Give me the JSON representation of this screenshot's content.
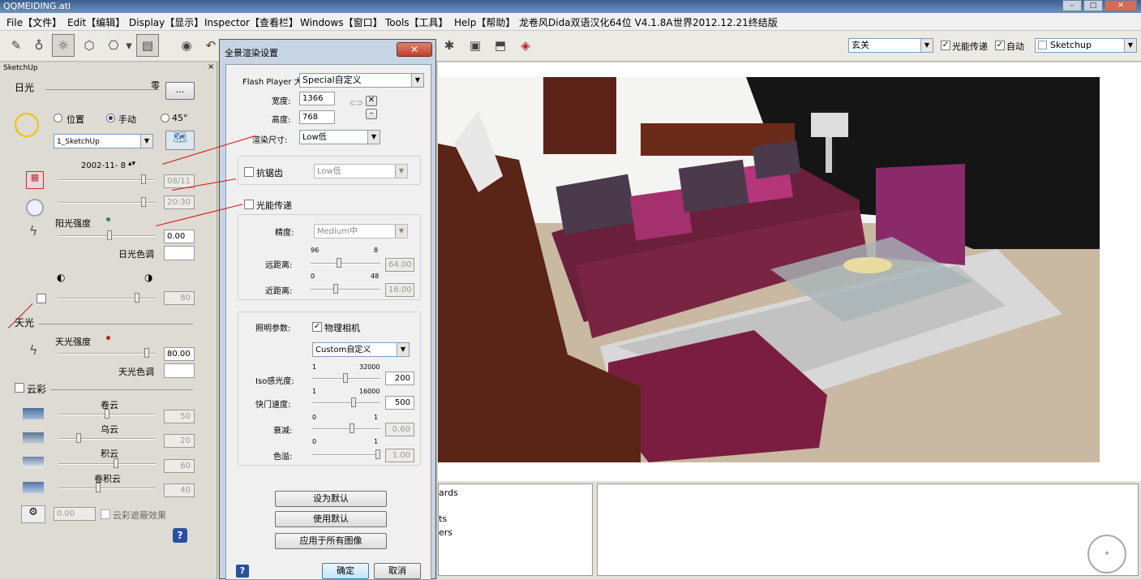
{
  "window": {
    "title": "QQMEIDING.atl"
  },
  "menu": [
    "File【文件】",
    "Edit【编辑】",
    "Display【显示】",
    "Inspector【查看栏】",
    "Windows【窗口】",
    "Tools【工具】",
    "Help【帮助】",
    "龙卷风Dida双语汉化64位 V4.1.8A",
    "世界2012.12.21终结版"
  ],
  "toolbar": {
    "camera_combo": "玄关",
    "gi_label": "光能传递",
    "gi_checked": true,
    "auto_label": "自动",
    "auto_checked": true,
    "source_combo": "Sketchup"
  },
  "sun_panel": {
    "header": "SketchUp",
    "sun_label": "日光",
    "sun_combo": "零",
    "sun_btn": "...",
    "radio_position": "位置",
    "radio_manual": "手动",
    "radio_45": "45°",
    "location_combo": "1_SketchUp",
    "date": "2002-11- 8",
    "date_val": "08/11",
    "time_val": "20:30",
    "intensity_label": "阳光强度",
    "intensity_val": "0.00",
    "color_label": "日光色调",
    "shadow_val": "80",
    "sky_label": "天光",
    "sky_intensity_label": "天光强度",
    "sky_intensity_val": "80.00",
    "sky_color_label": "天光色调",
    "clouds_label": "云彩",
    "cloud1": "卷云",
    "cloud1_val": "50",
    "cloud2": "乌云",
    "cloud2_val": "20",
    "cloud3": "积云",
    "cloud3_val": "60",
    "cloud4": "卷积云",
    "cloud4_val": "40",
    "cloud_offset": "0.00",
    "cloud_shadow": "云彩遮蔽效果"
  },
  "dialog": {
    "title": "全景渲染设置",
    "flash_label": "Flash Player 大",
    "flash_combo": "Special自定义",
    "width_label": "宽度:",
    "width_val": "1366",
    "height_label": "高度:",
    "height_val": "768",
    "render_size_label": "渲染尺寸:",
    "render_size_combo": "Low低",
    "antialias_label": "抗锯齿",
    "antialias_combo": "Low低",
    "gi_label": "光能传递",
    "precision_label": "精度:",
    "precision_combo": "Medium中",
    "far_label": "远距离:",
    "far_min": "96",
    "far_max": "8",
    "far_val": "64.00",
    "near_label": "近距离:",
    "near_min": "0",
    "near_max": "48",
    "near_val": "16.00",
    "light_label": "照明参数:",
    "camera_label": "物理相机",
    "camera_combo": "Custom自定义",
    "iso_label": "Iso感光度:",
    "iso_min": "1",
    "iso_max": "32000",
    "iso_val": "200",
    "shutter_label": "快门速度:",
    "shutter_min": "1",
    "shutter_max": "16000",
    "shutter_val": "500",
    "falloff_label": "衰减:",
    "falloff_min": "0",
    "falloff_max": "1",
    "falloff_val": "0.60",
    "tint_label": "色溢:",
    "tint_min": "0",
    "tint_max": "1",
    "tint_val": "1.00",
    "set_default": "设为默认",
    "use_default": "使用默认",
    "apply_all": "应用于所有图像",
    "ok": "确定",
    "cancel": "取消"
  },
  "bottom": {
    "items": [
      "ards",
      "ts",
      "ers"
    ]
  }
}
